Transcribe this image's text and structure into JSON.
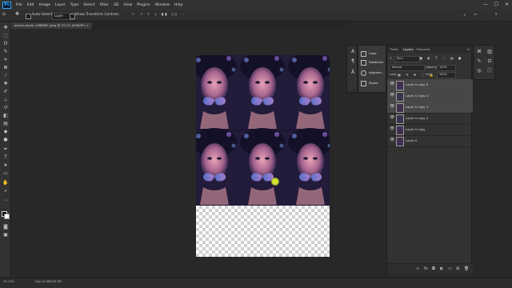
{
  "app": {
    "logo": "Ps"
  },
  "menu": [
    "File",
    "Edit",
    "Image",
    "Layer",
    "Type",
    "Select",
    "Filter",
    "3D",
    "View",
    "Plugins",
    "Window",
    "Help"
  ],
  "window_controls": [
    "—",
    "☐",
    "✕"
  ],
  "options_bar": {
    "auto_select_label": "Auto-Select:",
    "auto_select_value": "Layer",
    "show_transform_label": "Show Transform Controls"
  },
  "document": {
    "tab_title": "pexels-photo-1988681.jpeg @ 33.1% (RGB/8*) ×"
  },
  "tools": [
    "move",
    "artboard",
    "marquee",
    "lasso",
    "quick-select",
    "crop",
    "frame",
    "eyedropper",
    "healing",
    "brush",
    "stamp",
    "history",
    "eraser",
    "gradient",
    "blur",
    "dodge",
    "pen",
    "type",
    "path-select",
    "shape",
    "hand",
    "zoom",
    "more"
  ],
  "colors": {
    "foreground": "#000000",
    "background": "#ffffff",
    "accent": "#31a8ff"
  },
  "adjustments_panel": {
    "items": [
      {
        "label": "Color",
        "icon": "color-icon"
      },
      {
        "label": "Swatches",
        "icon": "swatches-icon"
      },
      {
        "label": "Adjustm...",
        "icon": "adjustments-icon"
      },
      {
        "label": "Styles",
        "icon": "styles-icon"
      }
    ]
  },
  "layers_panel": {
    "tabs": [
      {
        "label": "Paths"
      },
      {
        "label": "Layers"
      },
      {
        "label": "Channels"
      }
    ],
    "kind_filter": "Kind",
    "blend_mode": "Normal",
    "opacity_label": "Opacity:",
    "opacity_value": "100%",
    "lock_label": "Lock:",
    "fill_label": "Fill:",
    "fill_value": "100%",
    "layers": [
      {
        "name": "Layer 0 copy 5",
        "selected": true,
        "thumb": "photo"
      },
      {
        "name": "Layer 0 copy 4",
        "selected": true,
        "thumb": "photo"
      },
      {
        "name": "Layer 0 copy 3",
        "selected": true,
        "thumb": "photo"
      },
      {
        "name": "Layer 0 copy 2",
        "selected": false,
        "thumb": "photo"
      },
      {
        "name": "Layer 0 copy",
        "selected": false,
        "thumb": "photo"
      },
      {
        "name": "Layer 0",
        "selected": false,
        "thumb": "photo"
      }
    ]
  },
  "status": {
    "zoom": "33.13%",
    "doc_size": "Doc: 8.16M/16.3M"
  }
}
